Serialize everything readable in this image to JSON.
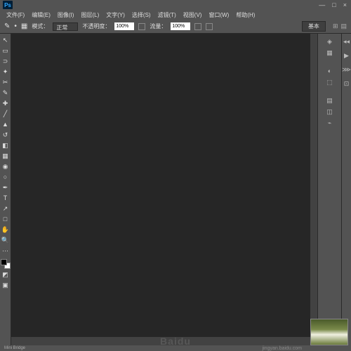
{
  "app": {
    "logo": "Ps"
  },
  "window_controls": {
    "min": "—",
    "max": "□",
    "close": "×"
  },
  "menu": {
    "items": [
      {
        "label": "文件(F)"
      },
      {
        "label": "编辑(E)"
      },
      {
        "label": "图像(I)"
      },
      {
        "label": "图层(L)"
      },
      {
        "label": "文字(Y)"
      },
      {
        "label": "选择(S)"
      },
      {
        "label": "滤镜(T)"
      },
      {
        "label": "视图(V)"
      },
      {
        "label": "窗口(W)"
      },
      {
        "label": "帮助(H)"
      }
    ]
  },
  "options": {
    "mode_label": "模式：",
    "mode_value": "正常",
    "opacity_label": "不透明度：",
    "opacity_value": "100%",
    "flow_label": "流量：",
    "flow_value": "100%",
    "workspace_label": "基本"
  },
  "tools": [
    "move",
    "marquee",
    "lasso",
    "wand",
    "crop",
    "eyedropper",
    "heal",
    "brush",
    "stamp",
    "history",
    "eraser",
    "gradient",
    "blur",
    "dodge",
    "pen",
    "type",
    "path",
    "rect",
    "hand",
    "zoom"
  ],
  "footer": {
    "mini_bridge": "Mini Bridge"
  },
  "watermark": {
    "main": "Baidu",
    "sub": "jingyan.baidu.com"
  }
}
